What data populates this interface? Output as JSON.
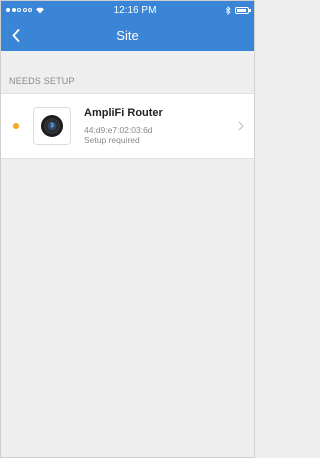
{
  "statusbar": {
    "time": "12:16 PM",
    "signal_dots": [
      true,
      true,
      false,
      false,
      false
    ],
    "icons": [
      "wifi-icon",
      "bluetooth-icon",
      "battery-icon"
    ]
  },
  "navbar": {
    "title": "Site",
    "back_icon": "chevron-left-icon",
    "color": "#3b85d6"
  },
  "section": {
    "header": "NEEDS SETUP"
  },
  "devices": [
    {
      "name": "AmpliFi Router",
      "mac": "44:d9:e7:02:03:6d",
      "status": "Setup required",
      "status_color": "#f5a623",
      "icon": "router-icon"
    }
  ]
}
